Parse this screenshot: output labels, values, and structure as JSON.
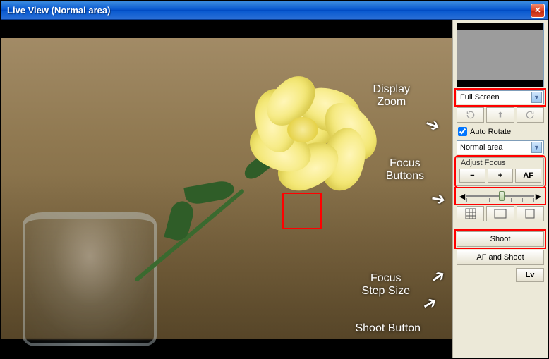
{
  "window": {
    "title": "Live View (Normal area)"
  },
  "callouts": {
    "display_zoom": "Display\nZoom",
    "focus_buttons": "Focus\nButtons",
    "focus_step": "Focus\nStep Size",
    "shoot_button": "Shoot Button"
  },
  "side": {
    "zoom_select": "Full Screen",
    "auto_rotate_label": "Auto Rotate",
    "area_select": "Normal area",
    "adjust_focus_label": "Adjust Focus",
    "minus": "−",
    "plus": "+",
    "af": "AF",
    "shoot": "Shoot",
    "af_and_shoot": "AF and Shoot",
    "lv": "Lv"
  }
}
